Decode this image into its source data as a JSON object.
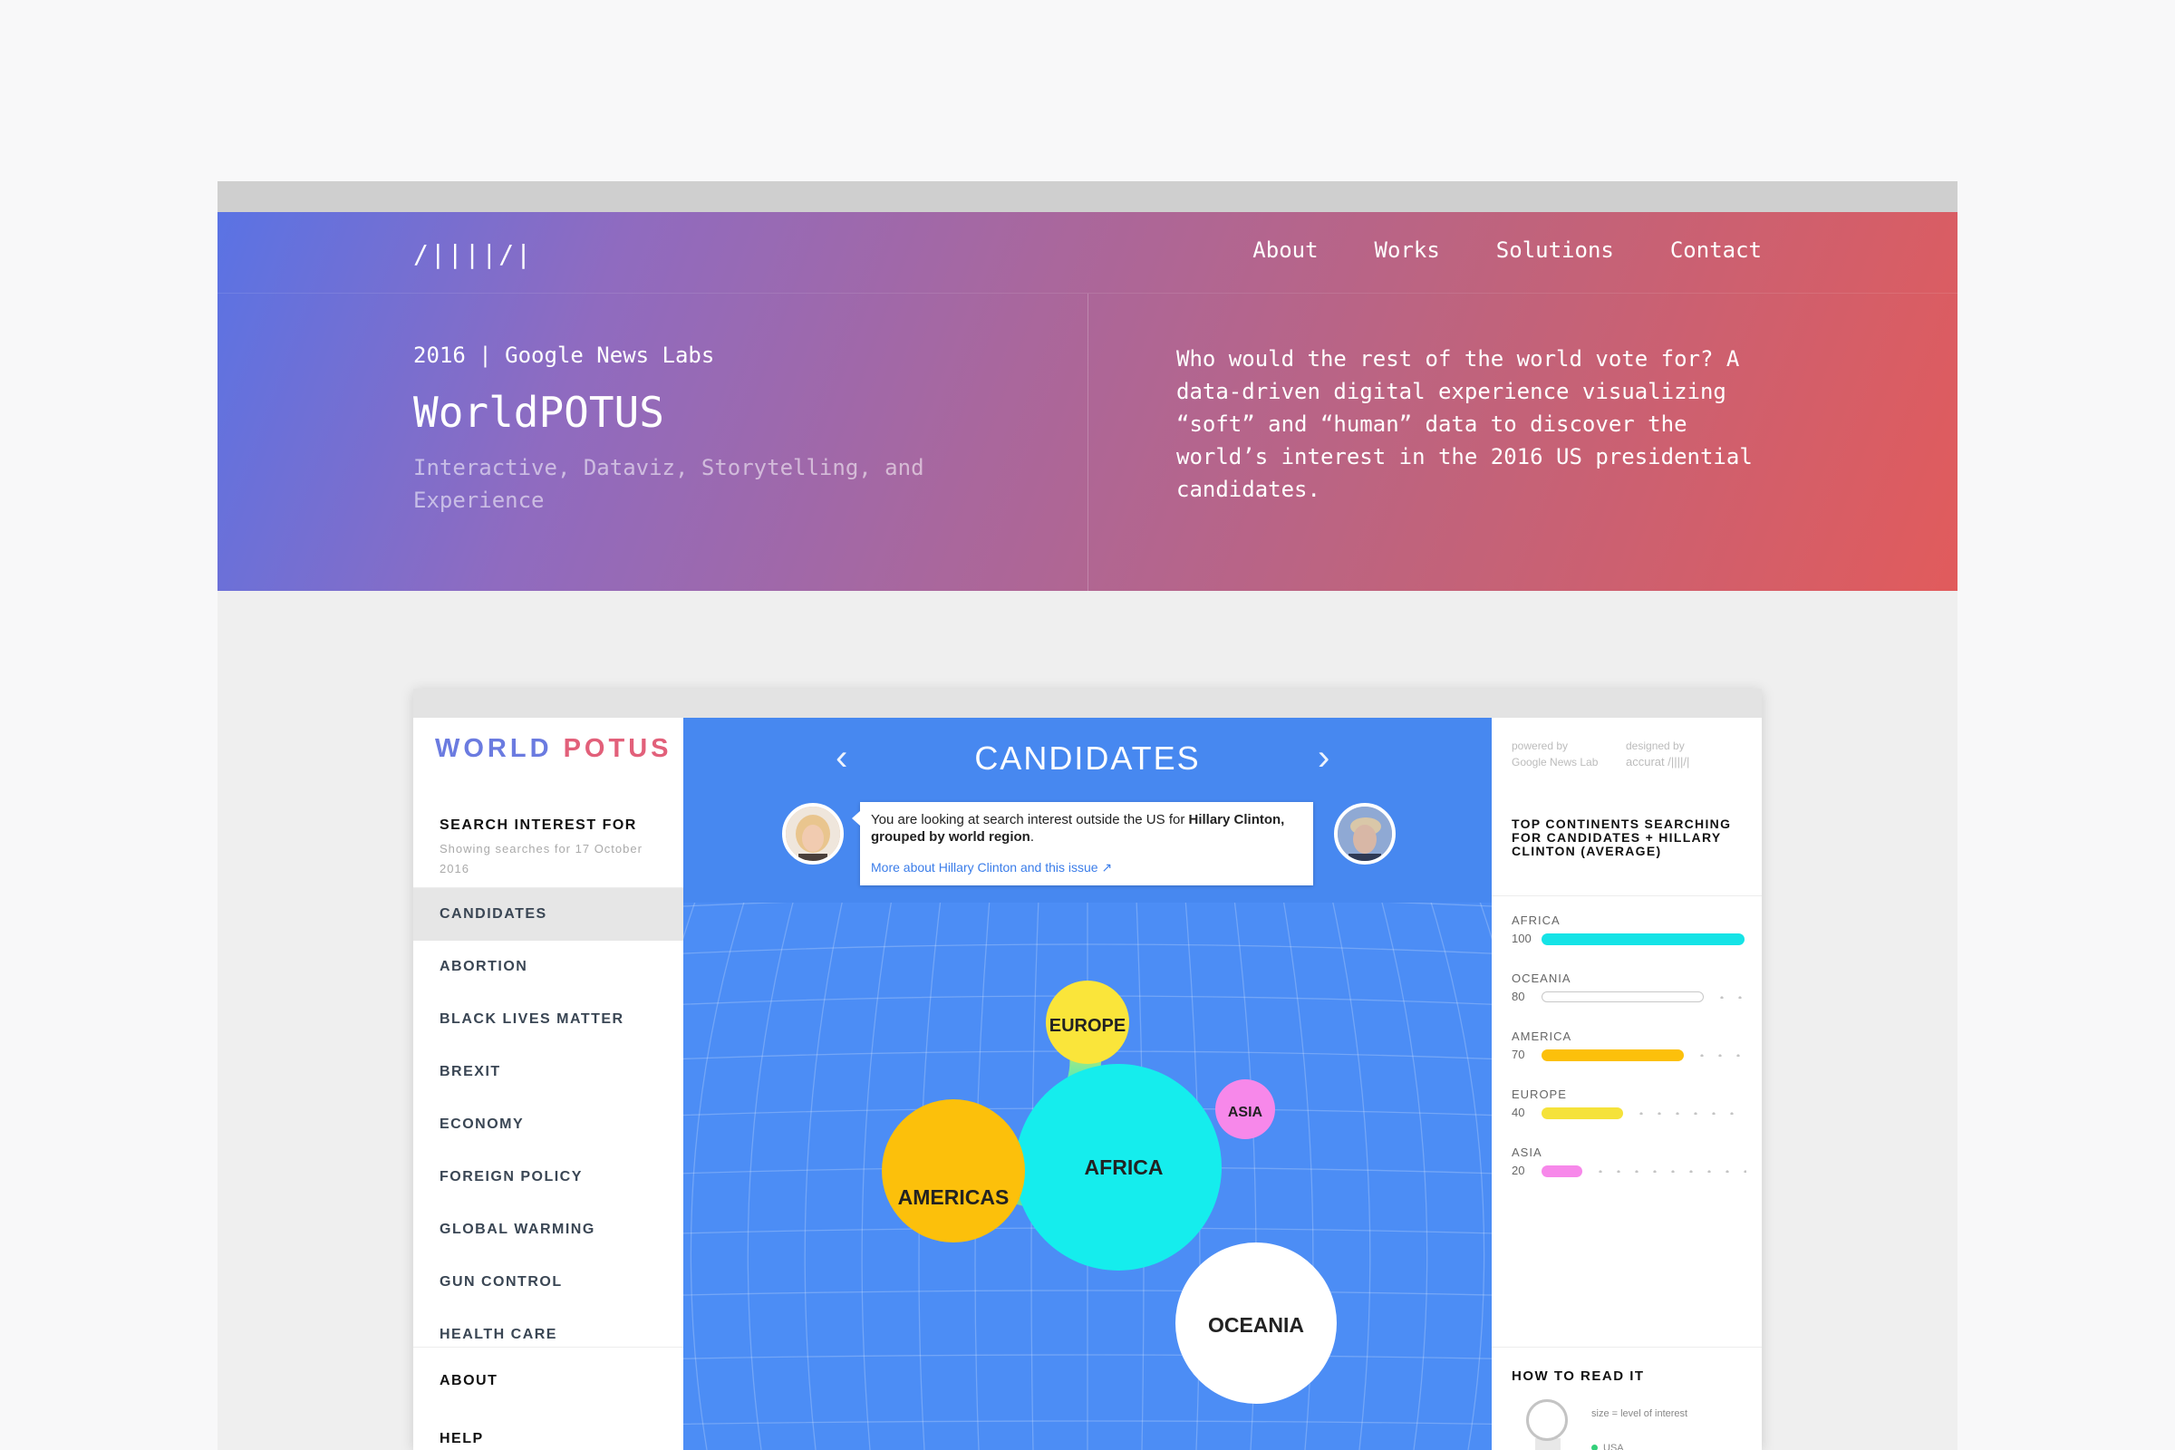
{
  "site": {
    "logo": "/||||/|",
    "nav": [
      "About",
      "Works",
      "Solutions",
      "Contact"
    ]
  },
  "hero": {
    "meta": "2016 | Google News Labs",
    "title": "WorldPOTUS",
    "tags": "Interactive, Dataviz, Storytelling, and Experience",
    "description": "Who would the rest of the world vote for? A data-driven digital experience visualizing “soft” and “human” data to discover the world’s interest in the 2016 US presidential candidates."
  },
  "app": {
    "logo_part1": "WORLD",
    "logo_part2": "POTUS",
    "search_label": "SEARCH INTEREST FOR",
    "search_sub": "Showing searches for 17 October 2016",
    "menu": [
      "CANDIDATES",
      "ABORTION",
      "BLACK LIVES MATTER",
      "BREXIT",
      "ECONOMY",
      "FOREIGN POLICY",
      "GLOBAL WARMING",
      "GUN CONTROL",
      "HEALTH CARE"
    ],
    "active_menu_index": 0,
    "footer": [
      "ABOUT",
      "HELP"
    ],
    "viz": {
      "title": "CANDIDATES",
      "prev_arrow": "‹",
      "next_arrow": "›",
      "info_text_1": "You are looking at search interest outside the US for ",
      "info_text_bold_1": "Hillary Clinton, grouped by world region",
      "info_text_2": ".",
      "info_link": "More about Hillary Clinton and this issue ↗",
      "bubbles": [
        {
          "label": "EUROPE",
          "color": "#fae53a"
        },
        {
          "label": "ASIA",
          "color": "#f788ea"
        },
        {
          "label": "AFRICA",
          "color": "#15eded"
        },
        {
          "label": "AMERICAS",
          "color": "#fcc00b"
        },
        {
          "label": "OCEANIA",
          "color": "#ffffff"
        }
      ]
    },
    "right_panel": {
      "powered_label": "powered by",
      "powered_value": "Google News Lab",
      "designed_label": "designed by",
      "designed_value": "accurat /||||/|",
      "top_title": "TOP CONTINENTS SEARCHING FOR CANDIDATES + HILLARY CLINTON (AVERAGE)",
      "bars": [
        {
          "name": "AFRICA",
          "value": 100,
          "color": "#15e3e6"
        },
        {
          "name": "OCEANIA",
          "value": 80,
          "color": "#ffffff"
        },
        {
          "name": "AMERICA",
          "value": 70,
          "color": "#fcc00b"
        },
        {
          "name": "EUROPE",
          "value": 40,
          "color": "#f5e23a"
        },
        {
          "name": "ASIA",
          "value": 20,
          "color": "#f788ea"
        }
      ],
      "read_title": "HOW TO READ IT",
      "read_size": "size = level of interest",
      "read_usa": "USA"
    }
  }
}
